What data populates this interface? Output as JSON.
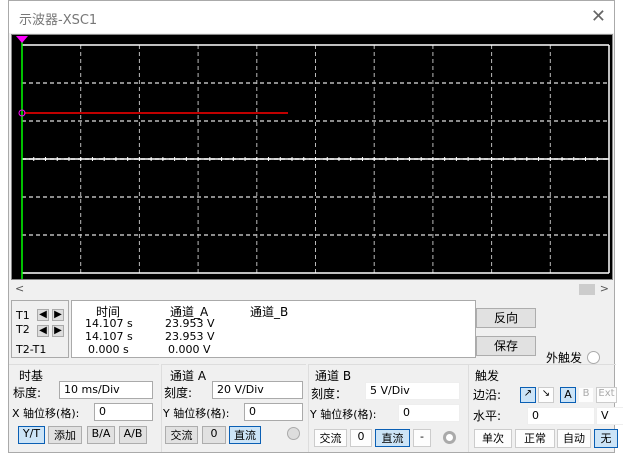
{
  "window": {
    "title": "示波器-XSC1",
    "close_icon": "close-icon"
  },
  "screen": {
    "background": "#000000",
    "trace_color": "#ff0000",
    "cursor_color": "#00ff00",
    "grid_color": "#cccccc"
  },
  "cursors": {
    "t1": "T1",
    "t2": "T2",
    "diff": "T2-T1"
  },
  "measurements": {
    "headers": [
      "时间",
      "通道_A",
      "通道_B"
    ],
    "rows": [
      [
        "14.107 s",
        "23.953 V",
        ""
      ],
      [
        "14.107 s",
        "23.953 V",
        ""
      ],
      [
        "0.000 s",
        "0.000 V",
        ""
      ]
    ]
  },
  "side": {
    "reverse": "反向",
    "save": "保存",
    "ext_trigger": "外触发"
  },
  "timebase": {
    "title": "时基",
    "scale_label": "标度:",
    "scale": "10 ms/Div",
    "xpos_label": "X 轴位移(格):",
    "xpos": "0",
    "modes": [
      "Y/T",
      "添加",
      "B/A",
      "A/B"
    ],
    "active_mode": "Y/T"
  },
  "channel_a": {
    "title": "通道 A",
    "scale_label": "刻度:",
    "scale": "20  V/Div",
    "ypos_label": "Y 轴位移(格):",
    "ypos": "0",
    "coupling": [
      "交流",
      "0",
      "直流"
    ],
    "active": "直流"
  },
  "channel_b": {
    "title": "通道 B",
    "scale_label": "刻度：",
    "scale": "5  V/Div",
    "ypos_label": "Y 轴位移(格):",
    "ypos": "0",
    "coupling": [
      "交流",
      "0",
      "直流",
      "-"
    ],
    "active": "直流"
  },
  "trigger": {
    "title": "触发",
    "edge_label": "边沿:",
    "edge_rise": "↗",
    "edge_fall": "↘",
    "sources": [
      "A",
      "B",
      "Ext"
    ],
    "active_source": "A",
    "level_label": "水平:",
    "level": "0",
    "unit": "V",
    "modes": [
      "单次",
      "正常",
      "自动",
      "无"
    ],
    "active_mode": "无"
  }
}
